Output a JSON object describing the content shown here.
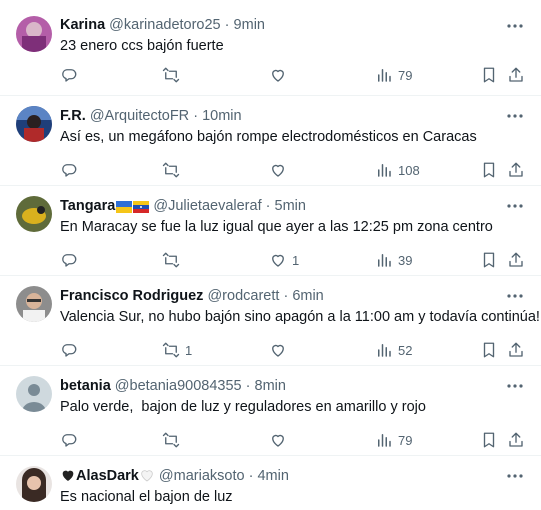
{
  "tweets": [
    {
      "name": "Karina",
      "handle": "@karinadetoro25",
      "sep": "·",
      "time": "9min",
      "text": "23 enero ccs bajón fuerte",
      "reply_count": "",
      "retweet_count": "",
      "like_count": "",
      "views": "79"
    },
    {
      "name": "F.R.",
      "handle": "@ArquitectoFR",
      "sep": "·",
      "time": "10min",
      "text": "Así es, un megáfono bajón rompe electrodomésticos en Caracas",
      "reply_count": "",
      "retweet_count": "",
      "like_count": "",
      "views": "108"
    },
    {
      "name": "Tangara",
      "handle": "@Julietaevaleraf",
      "sep": "·",
      "time": "5min",
      "text": "En Maracay se fue la luz igual que ayer a las 12:25 pm zona centro",
      "reply_count": "",
      "retweet_count": "",
      "like_count": "1",
      "views": "39",
      "name_flags": [
        "ukraine-flag",
        "venezuela-flag"
      ]
    },
    {
      "name": "Francisco Rodriguez",
      "handle": "@rodcarett",
      "sep": "·",
      "time": "6min",
      "text": "Valencia Sur, no hubo bajón sino apagón a la 11:00 am y todavía continúa!",
      "reply_count": "",
      "retweet_count": "1",
      "like_count": "",
      "views": "52"
    },
    {
      "name": "betania",
      "handle": "@betania90084355",
      "sep": "·",
      "time": "8min",
      "text": "Palo verde,  bajon de luz y reguladores en amarillo y rojo",
      "reply_count": "",
      "retweet_count": "",
      "like_count": "",
      "views": "79"
    },
    {
      "name": "AlasDark",
      "handle": "@mariaksoto",
      "sep": "·",
      "time": "4min",
      "text": "Es nacional el bajon de luz",
      "reply_count": "",
      "retweet_count": "",
      "like_count": "",
      "views": "",
      "name_icons": [
        "black-heart-icon",
        "white-heart-icon"
      ]
    }
  ],
  "icons": {
    "reply": "reply-icon",
    "retweet": "retweet-icon",
    "like": "heart-icon",
    "views": "views-chart-icon",
    "bookmark": "bookmark-icon",
    "share": "share-icon",
    "more": "more-dots-icon"
  },
  "colors": {
    "text": "#0f1419",
    "secondary": "#536471",
    "divider": "#eff3f4"
  }
}
